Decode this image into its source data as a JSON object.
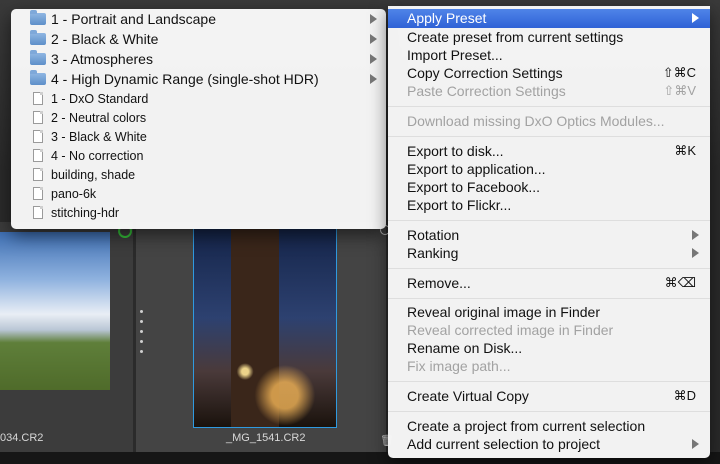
{
  "background": {
    "thumbnails": [
      {
        "caption": "034.CR2"
      },
      {
        "caption": "_MG_1541.CR2"
      }
    ]
  },
  "main_menu": {
    "items": [
      {
        "label": "Apply Preset",
        "shortcut": "",
        "submenu": true,
        "state": "highlighted"
      },
      {
        "label": "Create preset from current settings",
        "shortcut": "",
        "submenu": false,
        "state": "enabled"
      },
      {
        "label": "Import Preset...",
        "shortcut": "",
        "submenu": false,
        "state": "enabled"
      },
      {
        "label": "Copy Correction Settings",
        "shortcut": "⇧⌘C",
        "submenu": false,
        "state": "enabled"
      },
      {
        "label": "Paste Correction Settings",
        "shortcut": "⇧⌘V",
        "submenu": false,
        "state": "disabled"
      },
      {
        "label": "Download missing DxO Optics Modules...",
        "shortcut": "",
        "submenu": false,
        "state": "disabled"
      },
      {
        "label": "Export to disk...",
        "shortcut": "⌘K",
        "submenu": false,
        "state": "enabled"
      },
      {
        "label": "Export to application...",
        "shortcut": "",
        "submenu": false,
        "state": "enabled"
      },
      {
        "label": "Export to Facebook...",
        "shortcut": "",
        "submenu": false,
        "state": "enabled"
      },
      {
        "label": "Export to Flickr...",
        "shortcut": "",
        "submenu": false,
        "state": "enabled"
      },
      {
        "label": "Rotation",
        "shortcut": "",
        "submenu": true,
        "state": "enabled"
      },
      {
        "label": "Ranking",
        "shortcut": "",
        "submenu": true,
        "state": "enabled"
      },
      {
        "label": "Remove...",
        "shortcut": "⌘⌫",
        "submenu": false,
        "state": "enabled"
      },
      {
        "label": "Reveal original image in Finder",
        "shortcut": "",
        "submenu": false,
        "state": "enabled"
      },
      {
        "label": "Reveal corrected image in Finder",
        "shortcut": "",
        "submenu": false,
        "state": "disabled"
      },
      {
        "label": "Rename on Disk...",
        "shortcut": "",
        "submenu": false,
        "state": "enabled"
      },
      {
        "label": "Fix image path...",
        "shortcut": "",
        "submenu": false,
        "state": "disabled"
      },
      {
        "label": "Create Virtual Copy",
        "shortcut": "⌘D",
        "submenu": false,
        "state": "enabled"
      },
      {
        "label": "Create a project from current selection",
        "shortcut": "",
        "submenu": false,
        "state": "enabled"
      },
      {
        "label": "Add current selection to project",
        "shortcut": "",
        "submenu": true,
        "state": "enabled"
      }
    ]
  },
  "preset_submenu": {
    "items": [
      {
        "label": "1 - Portrait and Landscape",
        "kind": "folder"
      },
      {
        "label": "2 - Black & White",
        "kind": "folder"
      },
      {
        "label": "3 - Atmospheres",
        "kind": "folder"
      },
      {
        "label": "4 - High Dynamic Range (single-shot HDR)",
        "kind": "folder"
      },
      {
        "label": "1 - DxO Standard",
        "kind": "file"
      },
      {
        "label": "2 - Neutral colors",
        "kind": "file"
      },
      {
        "label": "3 - Black & White",
        "kind": "file"
      },
      {
        "label": "4 - No correction",
        "kind": "file"
      },
      {
        "label": "building, shade",
        "kind": "file"
      },
      {
        "label": "pano-6k",
        "kind": "file"
      },
      {
        "label": "stitching-hdr",
        "kind": "file"
      }
    ]
  }
}
